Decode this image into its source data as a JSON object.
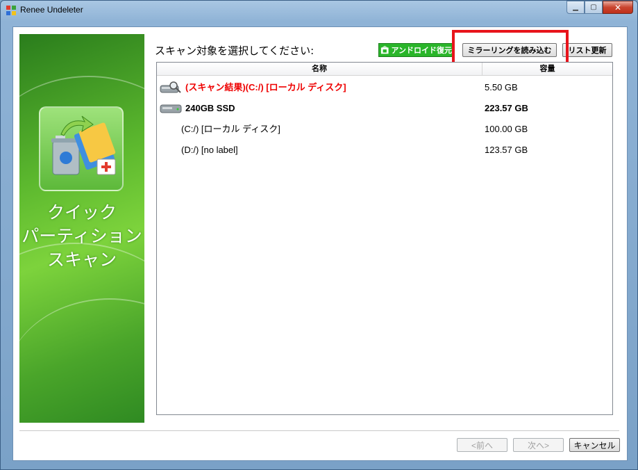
{
  "window": {
    "title": "Renee Undeleter"
  },
  "sidebar": {
    "title_lines": [
      "クイック",
      "パーティション",
      "スキャン"
    ]
  },
  "main": {
    "heading": "スキャン対象を選択してください:",
    "buttons": {
      "android": "アンドロイド復元",
      "mirror": "ミラーリングを読み込む",
      "refresh": "リスト更新"
    },
    "columns": {
      "name": "名称",
      "size": "容量"
    },
    "rows": [
      {
        "name": "(スキャン結果)(C:/) [ローカル ディスク]",
        "size": "5.50 GB",
        "style": "red",
        "icon": "disk-search-icon"
      },
      {
        "name": "240GB SSD",
        "size": "223.57 GB",
        "style": "bold",
        "icon": "disk-icon"
      },
      {
        "name": "(C:/) [ローカル ディスク]",
        "size": "100.00 GB",
        "style": "sub"
      },
      {
        "name": "(D:/) [no label]",
        "size": "123.57 GB",
        "style": "sub"
      }
    ]
  },
  "footer": {
    "prev": "<前へ",
    "next": "次へ>",
    "cancel": "キャンセル"
  },
  "colors": {
    "highlight": "#e8141b",
    "red_text": "#ee0000",
    "android_button": "#2ab52a"
  }
}
